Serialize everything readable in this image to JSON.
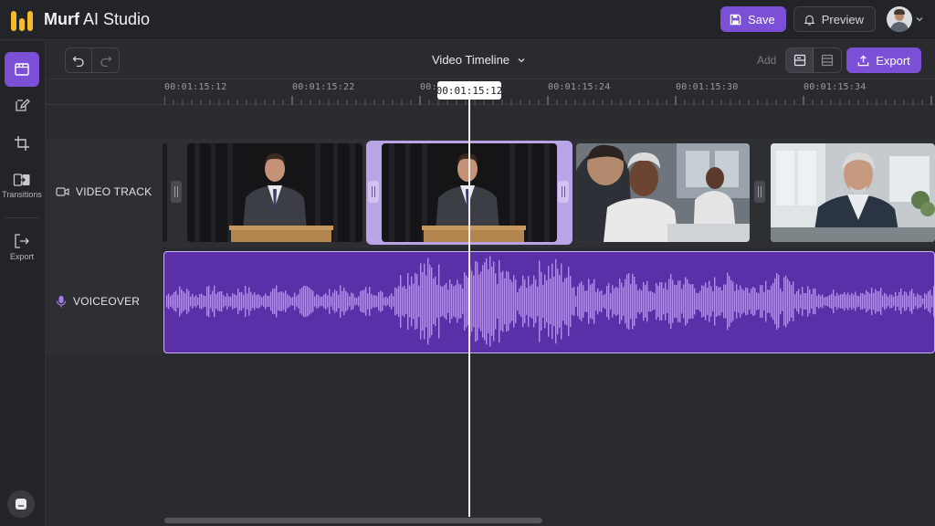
{
  "app": {
    "title_bold": "Murf",
    "title_rest": " AI Studio"
  },
  "header": {
    "save_label": "Save",
    "preview_label": "Preview"
  },
  "sidebar": {
    "items": [
      {
        "icon": "timeline-icon",
        "label": ""
      },
      {
        "icon": "edit-icon",
        "label": ""
      },
      {
        "icon": "crop-icon",
        "label": ""
      },
      {
        "icon": "transitions-icon",
        "label": "Transitions"
      },
      {
        "icon": "export-icon",
        "label": "Export"
      }
    ]
  },
  "toolbar": {
    "view_title": "Video Timeline",
    "add_label": "Add",
    "export_label": "Export"
  },
  "ruler": {
    "labels": [
      "00:01:15:12",
      "00:01:15:22",
      "00:",
      "00:01:15:24",
      "00:01:15:30",
      "00:01:15:34"
    ]
  },
  "playhead": {
    "time": "00:01:15:12"
  },
  "tracks": {
    "video_label": "VIDEO TRACK",
    "voice_label": "VOICEOVER"
  },
  "colors": {
    "accent": "#7b4fd6",
    "logo": "#f5b82e",
    "waveform": "#b48cf0"
  }
}
